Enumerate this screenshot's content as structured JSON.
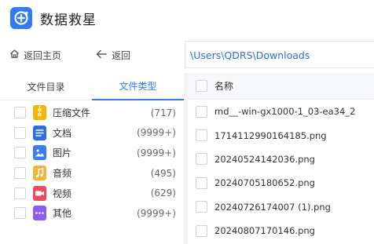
{
  "app": {
    "title": "数据救星",
    "logo_icon": "recovery-plus-icon",
    "brand_color": "#2f7cf6"
  },
  "toolbar": {
    "home_label": "返回主页",
    "back_label": "返回",
    "path": "\\Users\\QDRS\\Downloads"
  },
  "tabs": [
    {
      "label": "文件目录",
      "active": false
    },
    {
      "label": "文件类型",
      "active": true
    }
  ],
  "file_types": [
    {
      "name": "压缩文件",
      "count": "(717)",
      "icon": "archive-icon",
      "color": "#f7b500"
    },
    {
      "name": "文档",
      "count": "(9999+)",
      "icon": "document-icon",
      "color": "#2f6fe0"
    },
    {
      "name": "图片",
      "count": "(9999+)",
      "icon": "image-icon",
      "color": "#3b7cf0"
    },
    {
      "name": "音频",
      "count": "(495)",
      "icon": "music-icon",
      "color": "#f2b33a"
    },
    {
      "name": "视频",
      "count": "(629)",
      "icon": "video-icon",
      "color": "#ee4b5c"
    },
    {
      "name": "其他",
      "count": "(9999+)",
      "icon": "other-icon",
      "color": "#8a5cf0"
    }
  ],
  "file_list": {
    "header": "名称",
    "files": [
      "md__-win-gx1000-1_03-ea34_2",
      "1714112990164185.png",
      "20240524142036.png",
      "20240705180652.png",
      "20240726174007 (1).png",
      "20240807170146.png"
    ]
  }
}
